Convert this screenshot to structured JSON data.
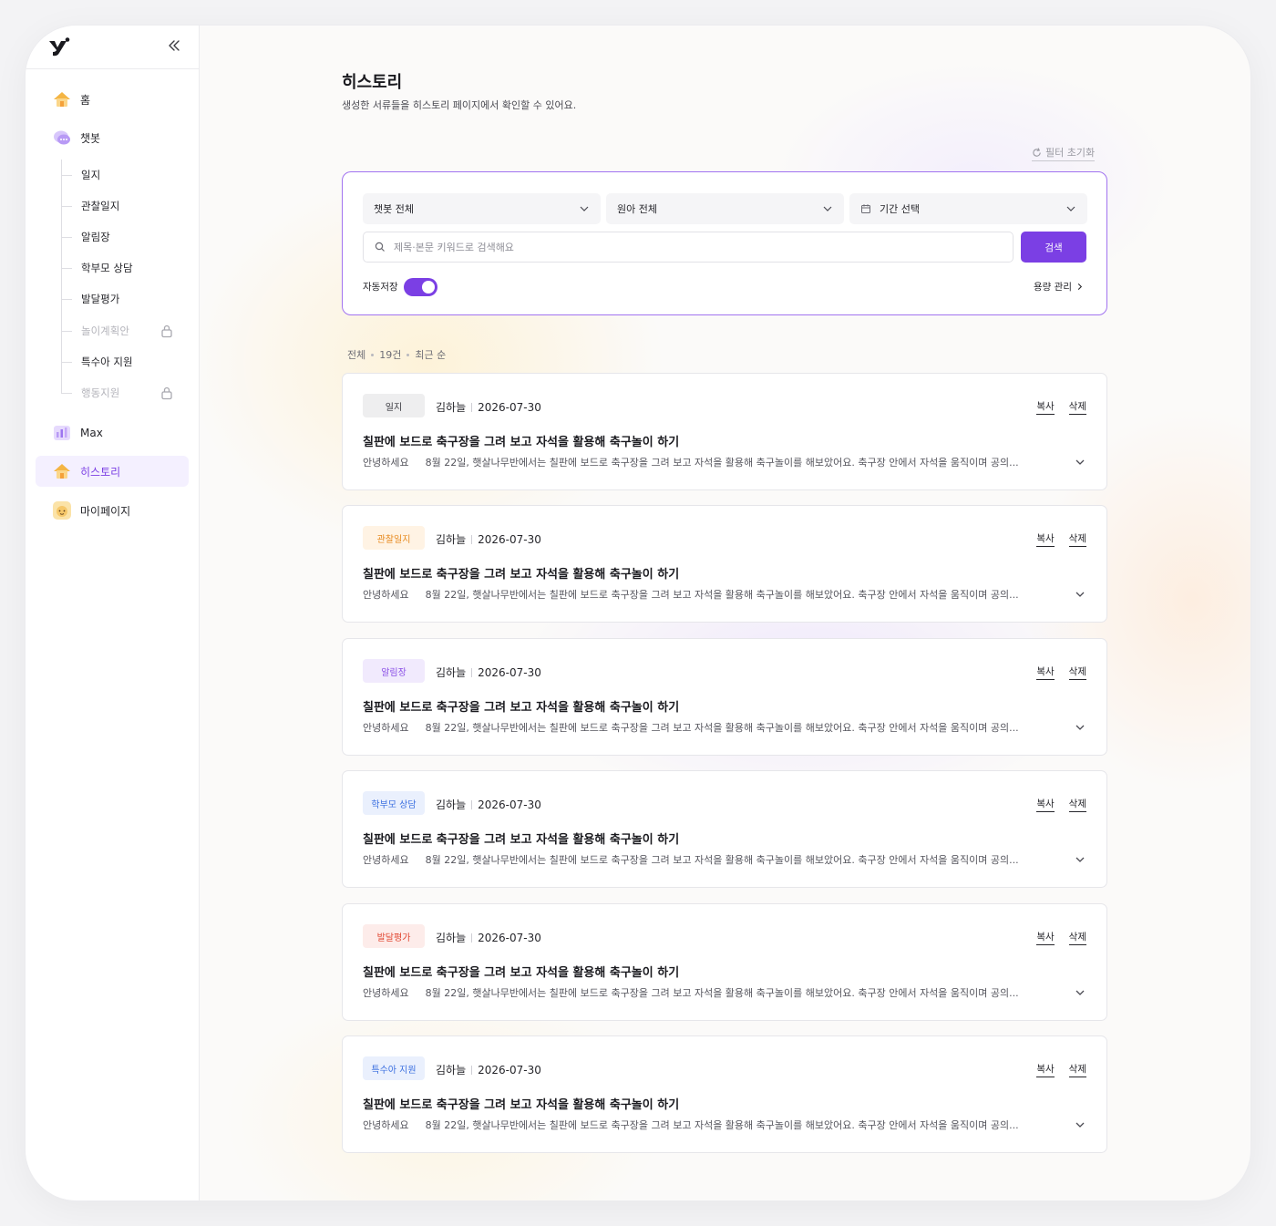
{
  "colors": {
    "accent": "#7b3fe4",
    "accent_border": "#a173f0",
    "badge_log_bg": "#eeeeef",
    "badge_observe_bg": "#fff3e4",
    "badge_observe_fg": "#e78a1f",
    "badge_notice_bg": "#f1eafd",
    "badge_notice_fg": "#8a4fe6",
    "badge_parent_bg": "#eaf0fd",
    "badge_parent_fg": "#3b6fe0",
    "badge_dev_bg": "#fdecea",
    "badge_dev_fg": "#e1442f",
    "badge_special_bg": "#eaf0fd",
    "badge_special_fg": "#3b6fe0"
  },
  "sidebar": {
    "home": "홈",
    "chatbot": "챗봇",
    "sub_items": [
      "일지",
      "관찰일지",
      "알림장",
      "학부모 상담",
      "발달평가",
      "놀이계획안",
      "특수아 지원",
      "행동지원"
    ],
    "max": "Max",
    "history": "히스토리",
    "mypage": "마이페이지"
  },
  "header": {
    "title": "히스토리",
    "subtitle": "생성한 서류들을 히스토리 페이지에서 확인할 수 있어요."
  },
  "filters": {
    "reset_label": "필터 초기화",
    "chatbot_select": "챗봇 전체",
    "child_select": "원아 전체",
    "period_select": "기간 선택",
    "search_placeholder": "제목·본문 키워드로 검색해요",
    "search_button": "검색",
    "autosave_label": "자동저장",
    "capacity_label": "용량 관리"
  },
  "summary": {
    "scope": "전체",
    "count": "19건",
    "sort": "최근 순"
  },
  "card_actions": {
    "copy": "복사",
    "delete": "삭제"
  },
  "cards": [
    {
      "badge": "일지",
      "author": "김하늘",
      "date": "2026-07-30",
      "title": "칠판에 보드로 축구장을 그려 보고 자석을 활용해 축구놀이 하기",
      "greeting": "안녕하세요",
      "preview": "8월 22일, 햇살나무반에서는 칠판에 보드로 축구장을 그려 보고 자석을 활용해 축구놀이를 해보았어요. 축구장 안에서 자석을 움직이며 공의..."
    },
    {
      "badge": "관찰일지",
      "author": "김하늘",
      "date": "2026-07-30",
      "title": "칠판에 보드로 축구장을 그려 보고 자석을 활용해 축구놀이 하기",
      "greeting": "안녕하세요",
      "preview": "8월 22일, 햇살나무반에서는 칠판에 보드로 축구장을 그려 보고 자석을 활용해 축구놀이를 해보았어요. 축구장 안에서 자석을 움직이며 공의..."
    },
    {
      "badge": "알림장",
      "author": "김하늘",
      "date": "2026-07-30",
      "title": "칠판에 보드로 축구장을 그려 보고 자석을 활용해 축구놀이 하기",
      "greeting": "안녕하세요",
      "preview": "8월 22일, 햇살나무반에서는 칠판에 보드로 축구장을 그려 보고 자석을 활용해 축구놀이를 해보았어요. 축구장 안에서 자석을 움직이며 공의..."
    },
    {
      "badge": "학부모 상담",
      "author": "김하늘",
      "date": "2026-07-30",
      "title": "칠판에 보드로 축구장을 그려 보고 자석을 활용해 축구놀이 하기",
      "greeting": "안녕하세요",
      "preview": "8월 22일, 햇살나무반에서는 칠판에 보드로 축구장을 그려 보고 자석을 활용해 축구놀이를 해보았어요. 축구장 안에서 자석을 움직이며 공의..."
    },
    {
      "badge": "발달평가",
      "author": "김하늘",
      "date": "2026-07-30",
      "title": "칠판에 보드로 축구장을 그려 보고 자석을 활용해 축구놀이 하기",
      "greeting": "안녕하세요",
      "preview": "8월 22일, 햇살나무반에서는 칠판에 보드로 축구장을 그려 보고 자석을 활용해 축구놀이를 해보았어요. 축구장 안에서 자석을 움직이며 공의..."
    },
    {
      "badge": "특수아 지원",
      "author": "김하늘",
      "date": "2026-07-30",
      "title": "칠판에 보드로 축구장을 그려 보고 자석을 활용해 축구놀이 하기",
      "greeting": "안녕하세요",
      "preview": "8월 22일, 햇살나무반에서는 칠판에 보드로 축구장을 그려 보고 자석을 활용해 축구놀이를 해보았어요. 축구장 안에서 자석을 움직이며 공의..."
    }
  ]
}
